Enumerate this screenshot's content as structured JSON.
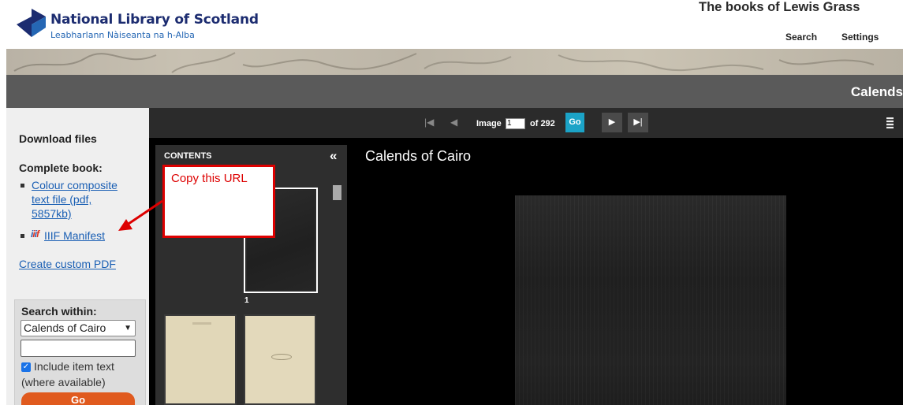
{
  "header": {
    "logo_title": "National Library of Scotland",
    "logo_subtitle": "Leabharlann Nàiseanta na h-Alba",
    "site_title": "The books of Lewis Grass",
    "nav": [
      "Search",
      "Settings"
    ]
  },
  "titlebar": {
    "book_title": "Calends"
  },
  "sidebar": {
    "download_heading": "Download files",
    "complete_book_heading": "Complete book:",
    "links": {
      "pdf_line1": "Colour composite",
      "pdf_line2": "text file (pdf,",
      "pdf_line3": "5857kb)",
      "iiif": "IIIF Manifest",
      "iiif_logo": "iiif",
      "custom_pdf": "Create custom PDF"
    },
    "search": {
      "label": "Search within:",
      "selected": "Calends of Cairo",
      "input_value": "",
      "checkbox_label": "Include item text",
      "checkbox_sub": "(where available)",
      "checkbox_checked": true,
      "go": "Go"
    }
  },
  "viewer": {
    "toolbar": {
      "image_label": "Image",
      "image_value": "1",
      "of_label": "of 292",
      "go": "Go"
    },
    "contents_label": "CONTENTS",
    "collapse_icon": "«",
    "thumb_number": "1",
    "title": "Calends of Cairo"
  },
  "annotation": {
    "text": "Copy this URL",
    "color": "#dd0000"
  },
  "colors": {
    "brand_navy": "#1c2c70",
    "link_blue": "#1a5fb4",
    "go_blue": "#1ba3c7",
    "go_orange": "#e05a1e"
  }
}
